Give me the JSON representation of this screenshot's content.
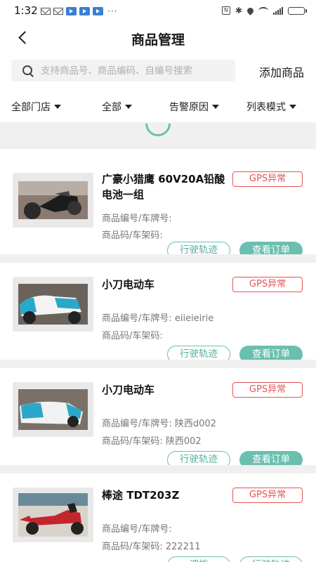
{
  "status_bar": {
    "time": "1:32",
    "more": "···",
    "nfc": "N",
    "bluetooth": "✱"
  },
  "header": {
    "title": "商品管理"
  },
  "search": {
    "placeholder": "支持商品号、商品编码、自编号搜索",
    "add_button": "添加商品"
  },
  "filters": [
    {
      "label": "全部门店"
    },
    {
      "label": "全部"
    },
    {
      "label": "告警原因"
    },
    {
      "label": "列表模式"
    }
  ],
  "colors": {
    "accent": "#6bbfb0",
    "alert": "#e55454"
  },
  "products": [
    {
      "name": "广豪小猎鹰 60V20A铅酸电池一组",
      "badge": "GPS异常",
      "meta1": "商品编号/车牌号:",
      "meta2": "商品码/车架码:",
      "btn_left": "行驶轨迹",
      "btn_right": "查看订单",
      "right_style": "solid"
    },
    {
      "name": "小刀电动车",
      "badge": "GPS异常",
      "meta1": "商品编号/车牌号: eiieieirie",
      "meta2": "商品码/车架码:",
      "btn_left": "行驶轨迹",
      "btn_right": "查看订单",
      "right_style": "solid"
    },
    {
      "name": "小刀电动车",
      "badge": "GPS异常",
      "meta1": "商品编号/车牌号: 陕西d002",
      "meta2": "商品码/车架码: 陕西002",
      "btn_left": "行驶轨迹",
      "btn_right": "查看订单",
      "right_style": "solid"
    },
    {
      "name": "棒途 TDT203Z",
      "badge": "GPS异常",
      "meta1": "商品编号/车牌号:",
      "meta2": "商品码/车架码: 222211",
      "btn_left": "调拨",
      "btn_right": "行驶轨迹",
      "right_style": "outline"
    }
  ]
}
